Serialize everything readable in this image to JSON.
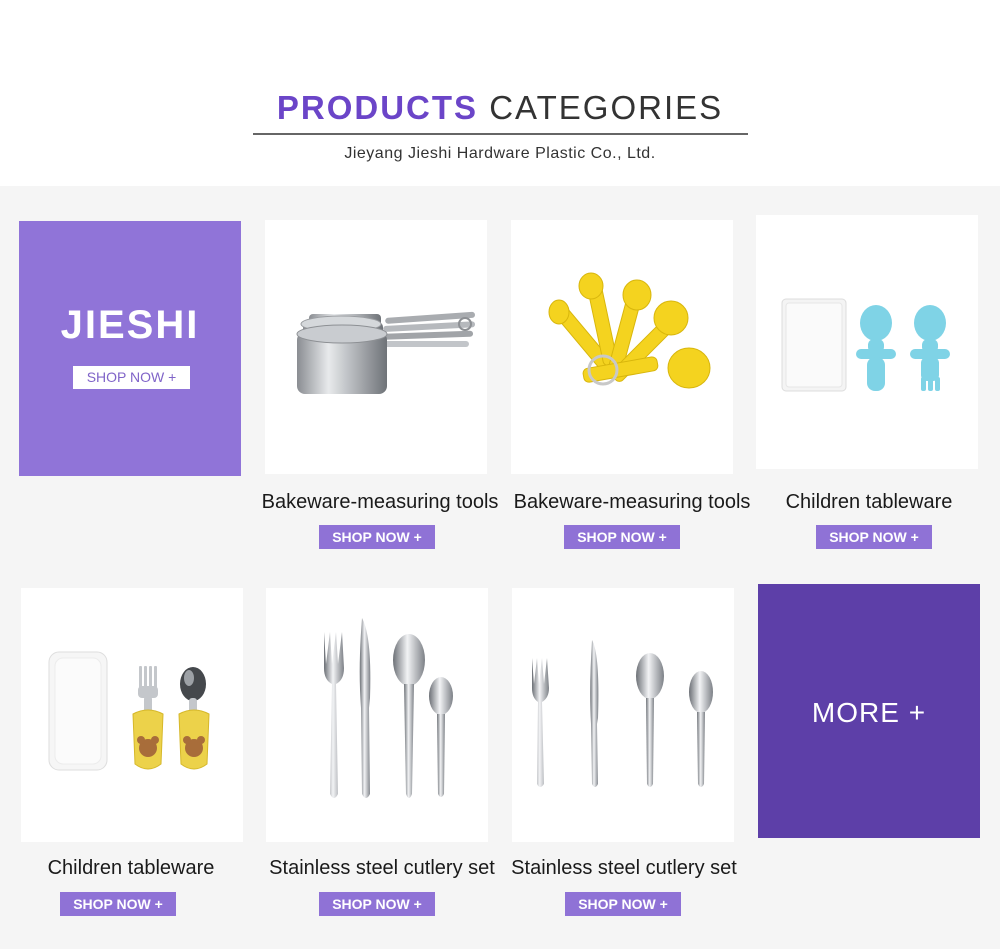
{
  "header": {
    "title_highlight": "PRODUCTS",
    "title_rest": "CATEGORIES",
    "subtitle": "Jieyang Jieshi Hardware Plastic Co., Ltd."
  },
  "promo": {
    "brand": "JIESHI",
    "button": "SHOP NOW +"
  },
  "more": {
    "label": "MORE +"
  },
  "products": [
    {
      "name": "Bakeware-measuring tools",
      "button": "SHOP NOW +",
      "icon": "measuring-cups-icon"
    },
    {
      "name": "Bakeware-measuring tools",
      "button": "SHOP NOW +",
      "icon": "measuring-spoons-icon"
    },
    {
      "name": "Children tableware",
      "button": "SHOP NOW +",
      "icon": "baby-spoon-fork-icon"
    },
    {
      "name": "Children tableware",
      "button": "SHOP NOW +",
      "icon": "kids-cutlery-icon"
    },
    {
      "name": "Stainless steel cutlery set",
      "button": "SHOP NOW +",
      "icon": "cutlery-set-icon"
    },
    {
      "name": "Stainless steel cutlery set",
      "button": "SHOP NOW +",
      "icon": "cutlery-set-icon"
    }
  ],
  "colors": {
    "accent": "#6b45c8",
    "promo_bg": "#9074d8",
    "more_bg": "#5d3fa8",
    "button_bg": "#8f72d6"
  }
}
